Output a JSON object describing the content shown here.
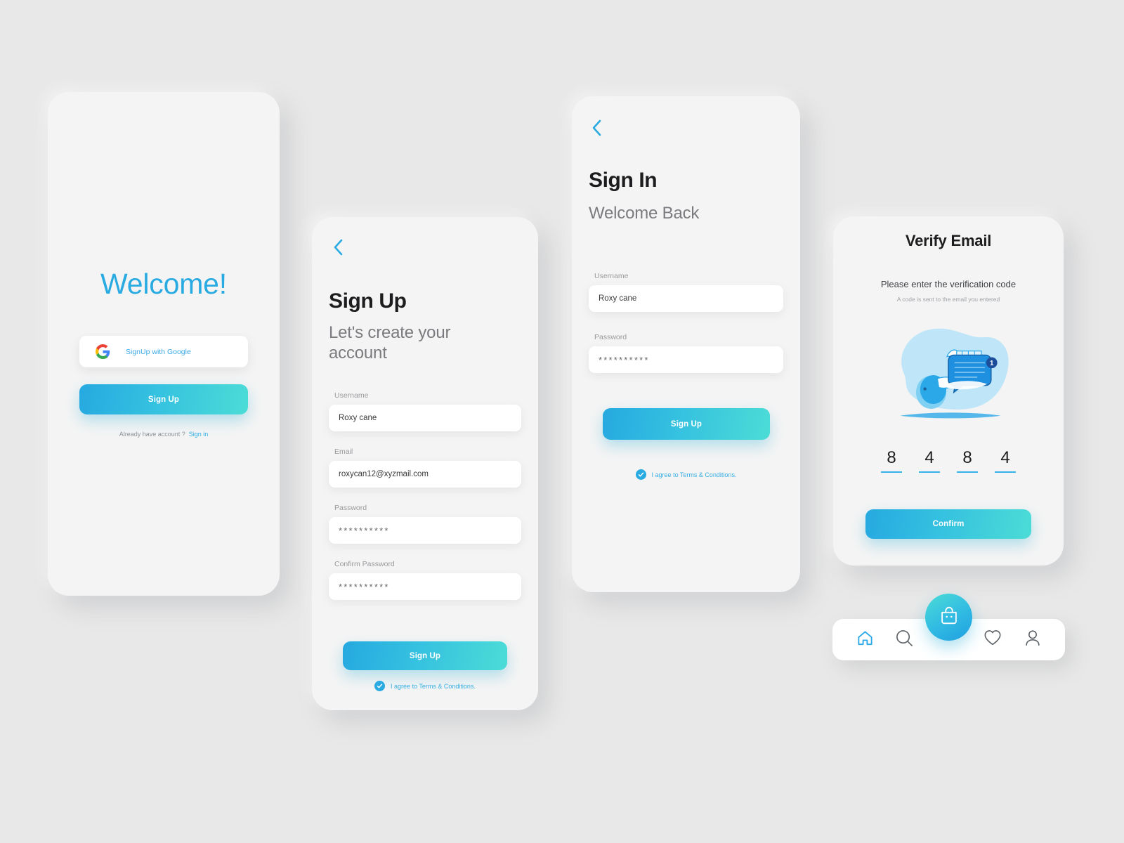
{
  "palette": {
    "brand_blue": "#29abe2",
    "gradient_start": "#26a9e0",
    "gradient_end": "#4cdcd6",
    "page_bg": "#e8e8e8",
    "card_bg": "#f4f4f4",
    "text_dark": "#1d1d1f",
    "text_muted": "#9a9a9e"
  },
  "screens": {
    "welcome": {
      "title": "Welcome!",
      "google_button": {
        "label": "SignUp with Google",
        "icon": "google-g-icon"
      },
      "signup_button": "Sign Up",
      "footer_text": "Already have account ?",
      "footer_link": "Sign in"
    },
    "signup": {
      "back_icon": "chevron-left-icon",
      "title": "Sign Up",
      "subtitle": "Let's create your account",
      "fields": [
        {
          "label": "Username",
          "value": "Roxy cane",
          "placeholder": "Username",
          "type": "text"
        },
        {
          "label": "Email",
          "value": "roxycan12@xyzmail.com",
          "placeholder": "Email",
          "type": "text"
        },
        {
          "label": "Password",
          "value": "**********",
          "placeholder": "Password",
          "type": "password"
        },
        {
          "label": "Confirm Password",
          "value": "**********",
          "placeholder": "Confirm Password",
          "type": "password"
        }
      ],
      "submit_button": "Sign Up",
      "terms_text": "I agree to Terms & Conditions.",
      "terms_checked": true
    },
    "signin": {
      "back_icon": "chevron-left-icon",
      "title": "Sign In",
      "subtitle": "Welcome Back",
      "fields": [
        {
          "label": "Username",
          "value": "Roxy cane",
          "placeholder": "Username",
          "type": "text"
        },
        {
          "label": "Password",
          "value": "**********",
          "placeholder": "Password",
          "type": "password"
        }
      ],
      "submit_button": "Sign Up",
      "terms_text": "I agree to Terms & Conditions.",
      "terms_checked": true
    },
    "verify": {
      "title": "Verify Email",
      "lead": "Please enter the verification code",
      "subtext": "A code is sent to the email you entered",
      "illustration": "hand-holding-message-bubble-illustration",
      "badge_count": "1",
      "otp_digits": [
        "8",
        "4",
        "8",
        "4"
      ],
      "confirm_button": "Confirm"
    }
  },
  "bottom_nav": {
    "items": [
      {
        "icon": "home-icon",
        "active": true
      },
      {
        "icon": "search-icon",
        "active": false
      },
      {
        "icon": "heart-icon",
        "active": false
      },
      {
        "icon": "profile-icon",
        "active": false
      }
    ],
    "fab": {
      "icon": "shopping-bag-icon"
    }
  }
}
